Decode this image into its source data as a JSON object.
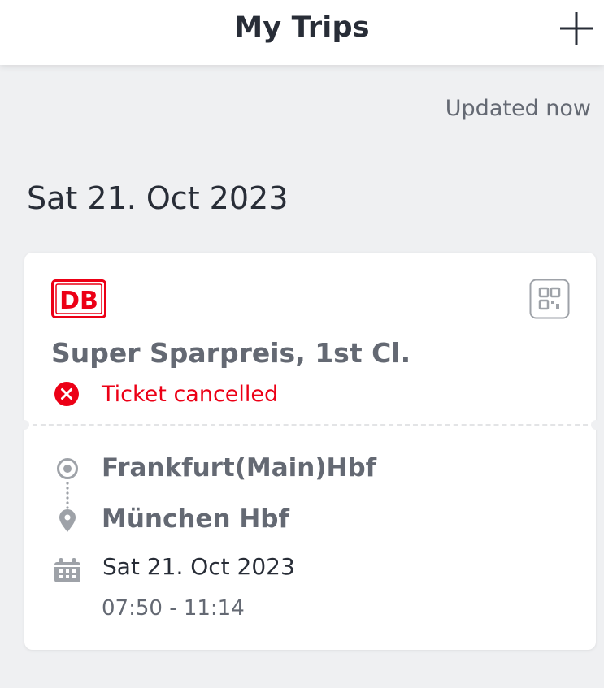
{
  "header": {
    "title": "My Trips",
    "add_icon": "plus-icon"
  },
  "updated_text": "Updated now",
  "date_heading": "Sat 21. Oct 2023",
  "trip_card": {
    "operator_logo": "DB",
    "qr_icon": "qr-code-icon",
    "ticket_name": "Super Sparpreis, 1st Cl.",
    "status": {
      "icon": "error-x-icon",
      "text": "Ticket cancelled"
    },
    "from_station": "Frankfurt(Main)Hbf",
    "to_station": "München Hbf",
    "date": "Sat 21. Oct 2023",
    "time": "07:50 - 11:14"
  },
  "colors": {
    "background": "#eff0f2",
    "db_red": "#ec0016",
    "text_dark": "#282d37",
    "text_gray": "#646973",
    "icon_gray": "#9ea2a8"
  }
}
